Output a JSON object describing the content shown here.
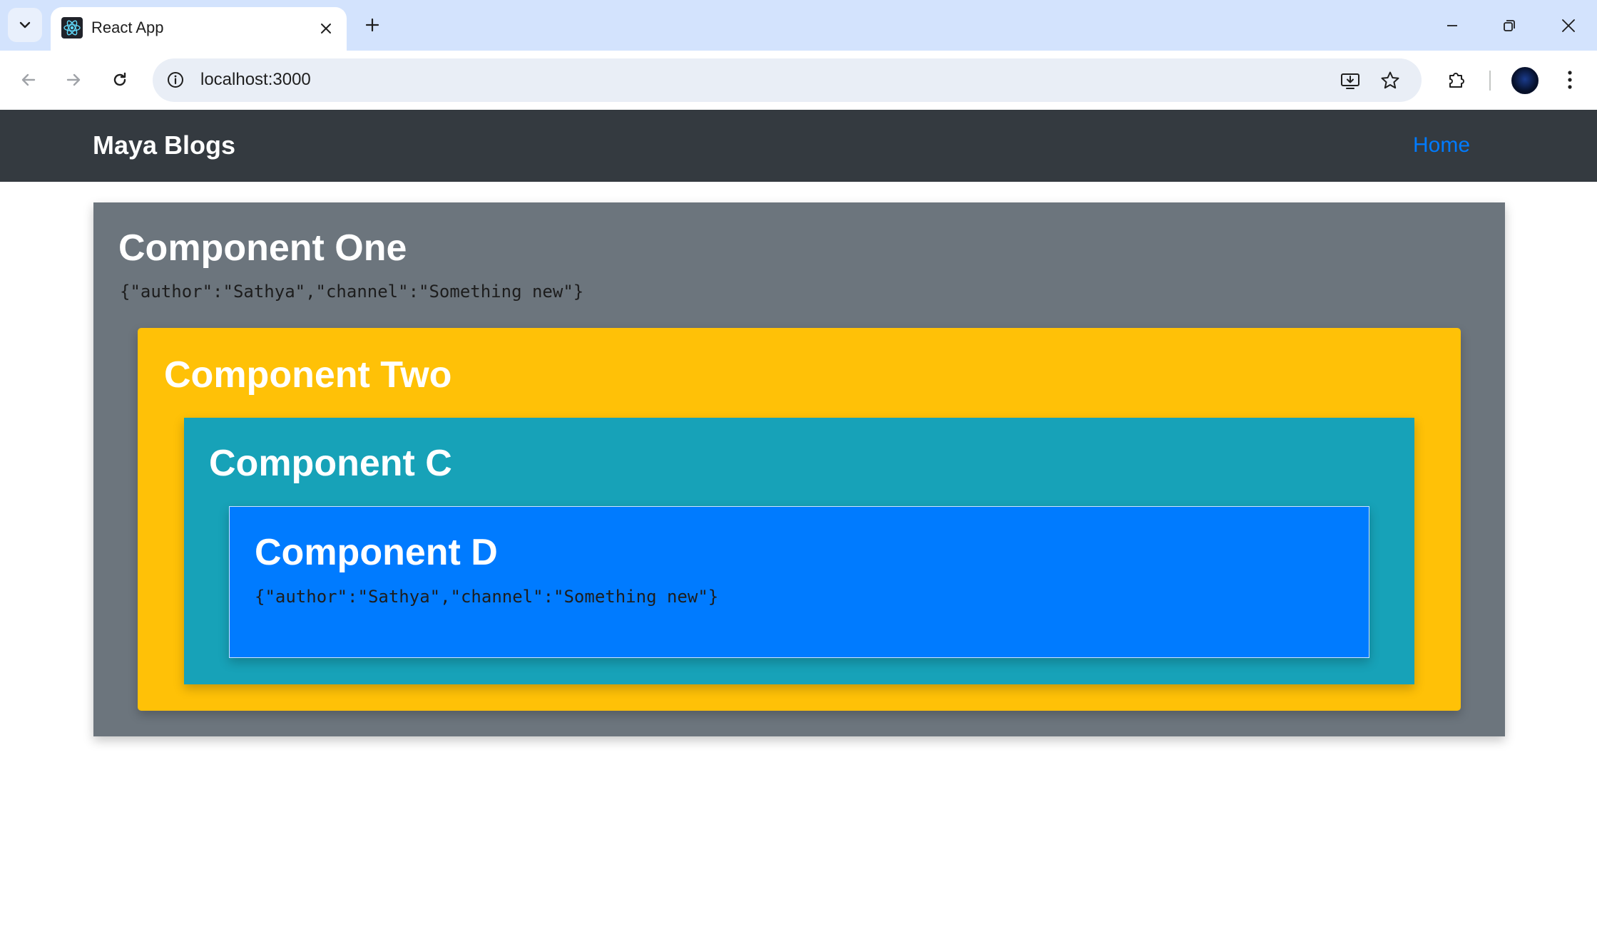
{
  "browser": {
    "tab_title": "React App",
    "url": "localhost:3000",
    "icons": {
      "tab_search": "chevron-down-icon",
      "favicon": "react-logo-icon",
      "tab_close": "close-icon",
      "new_tab": "plus-icon",
      "minimize": "minimize-icon",
      "restore": "restore-icon",
      "close_window": "close-icon",
      "back": "arrow-left-icon",
      "forward": "arrow-right-icon",
      "reload": "reload-icon",
      "site_info": "info-icon",
      "install_app": "install-icon",
      "bookmark": "star-icon",
      "extensions": "puzzle-icon",
      "profile": "avatar-icon",
      "menu": "kebab-menu-icon"
    }
  },
  "navbar": {
    "brand": "Maya Blogs",
    "links": [
      {
        "label": "Home"
      }
    ]
  },
  "components": {
    "one": {
      "title": "Component One",
      "json": "{\"author\":\"Sathya\",\"channel\":\"Something new\"}"
    },
    "two": {
      "title": "Component Two"
    },
    "c": {
      "title": "Component C"
    },
    "d": {
      "title": "Component D",
      "json": "{\"author\":\"Sathya\",\"channel\":\"Something new\"}"
    }
  },
  "colors": {
    "tabstrip": "#d3e3fd",
    "navbar": "#343a40",
    "link": "#007bff",
    "component_one": "#6c757d",
    "component_two": "#ffc107",
    "component_c": "#17a2b8",
    "component_d": "#007bff"
  }
}
